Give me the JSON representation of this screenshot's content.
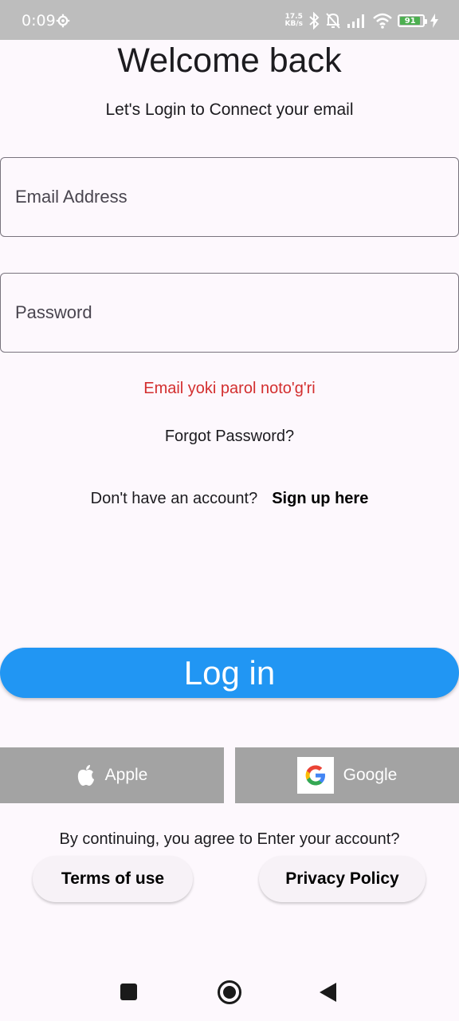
{
  "status_bar": {
    "time": "0:09",
    "net_speed_value": "17.5",
    "net_speed_unit": "KB/s",
    "battery": "91",
    "icons": [
      "settings-gear-icon",
      "bluetooth-icon",
      "mute-bell-icon",
      "signal-icon",
      "wifi-icon",
      "battery-icon",
      "charging-icon"
    ]
  },
  "header": {
    "title": "Welcome back",
    "subtitle": "Let's Login to Connect your email"
  },
  "form": {
    "email_placeholder": "Email Address",
    "email_value": "",
    "password_placeholder": "Password",
    "password_value": "",
    "error": "Email yoki parol noto'g'ri",
    "forgot_password": "Forgot Password?",
    "signup_prompt": "Don't have an account?",
    "signup_link": "Sign up here",
    "login_button": "Log in"
  },
  "social": {
    "apple_label": "Apple",
    "google_label": "Google"
  },
  "legal": {
    "agree_text": "By continuing, you agree to Enter your account?",
    "terms_label": "Terms of use",
    "privacy_label": "Privacy Policy"
  },
  "colors": {
    "accent": "#2196f3",
    "error": "#d32f2f",
    "social_button": "#a3a3a3",
    "background": "#fdf8fd"
  }
}
